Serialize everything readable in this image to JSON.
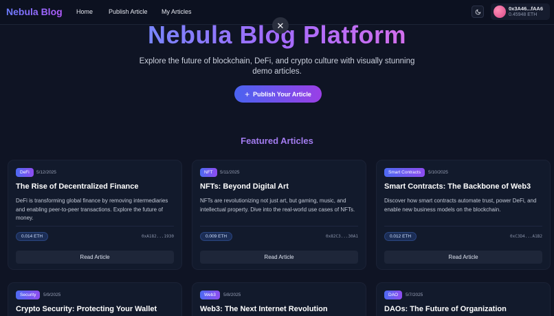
{
  "nav": {
    "brand": "Nebula Blog",
    "links": [
      "Home",
      "Publish Article",
      "My Articles"
    ],
    "wallet_address": "0x3A46...fAA6",
    "wallet_balance": "0.45948 ETH"
  },
  "hero": {
    "title": "Nebula Blog Platform",
    "close_symbol": "✕",
    "subtitle": "Explore the future of blockchain, DeFi, and crypto culture with visually stunning demo articles.",
    "cta_icon": "+",
    "cta_label": "Publish Your Article"
  },
  "section_title": "Featured Articles",
  "cards": [
    {
      "tag": "DeFi",
      "date": "5/12/2025",
      "title": "The Rise of Decentralized Finance",
      "excerpt": "DeFi is transforming global finance by removing intermediaries and enabling peer-to-peer transactions. Explore the future of money.",
      "price": "0.014 ETH",
      "author": "0xA182...1930",
      "button": "Read Article"
    },
    {
      "tag": "NFT",
      "date": "5/11/2025",
      "title": "NFTs: Beyond Digital Art",
      "excerpt": "NFTs are revolutionizing not just art, but gaming, music, and intellectual property. Dive into the real-world use cases of NFTs.",
      "price": "0.009 ETH",
      "author": "0x82C3...30A1",
      "button": "Read Article"
    },
    {
      "tag": "Smart Contracts",
      "date": "5/10/2025",
      "title": "Smart Contracts: The Backbone of Web3",
      "excerpt": "Discover how smart contracts automate trust, power DeFi, and enable new business models on the blockchain.",
      "price": "0.012 ETH",
      "author": "0xC3D4...A1B2",
      "button": "Read Article"
    },
    {
      "tag": "Security",
      "date": "5/9/2025",
      "title": "Crypto Security: Protecting Your Wallet"
    },
    {
      "tag": "Web3",
      "date": "5/8/2025",
      "title": "Web3: The Next Internet Revolution"
    },
    {
      "tag": "DAO",
      "date": "5/7/2025",
      "title": "DAOs: The Future of Organization"
    }
  ]
}
